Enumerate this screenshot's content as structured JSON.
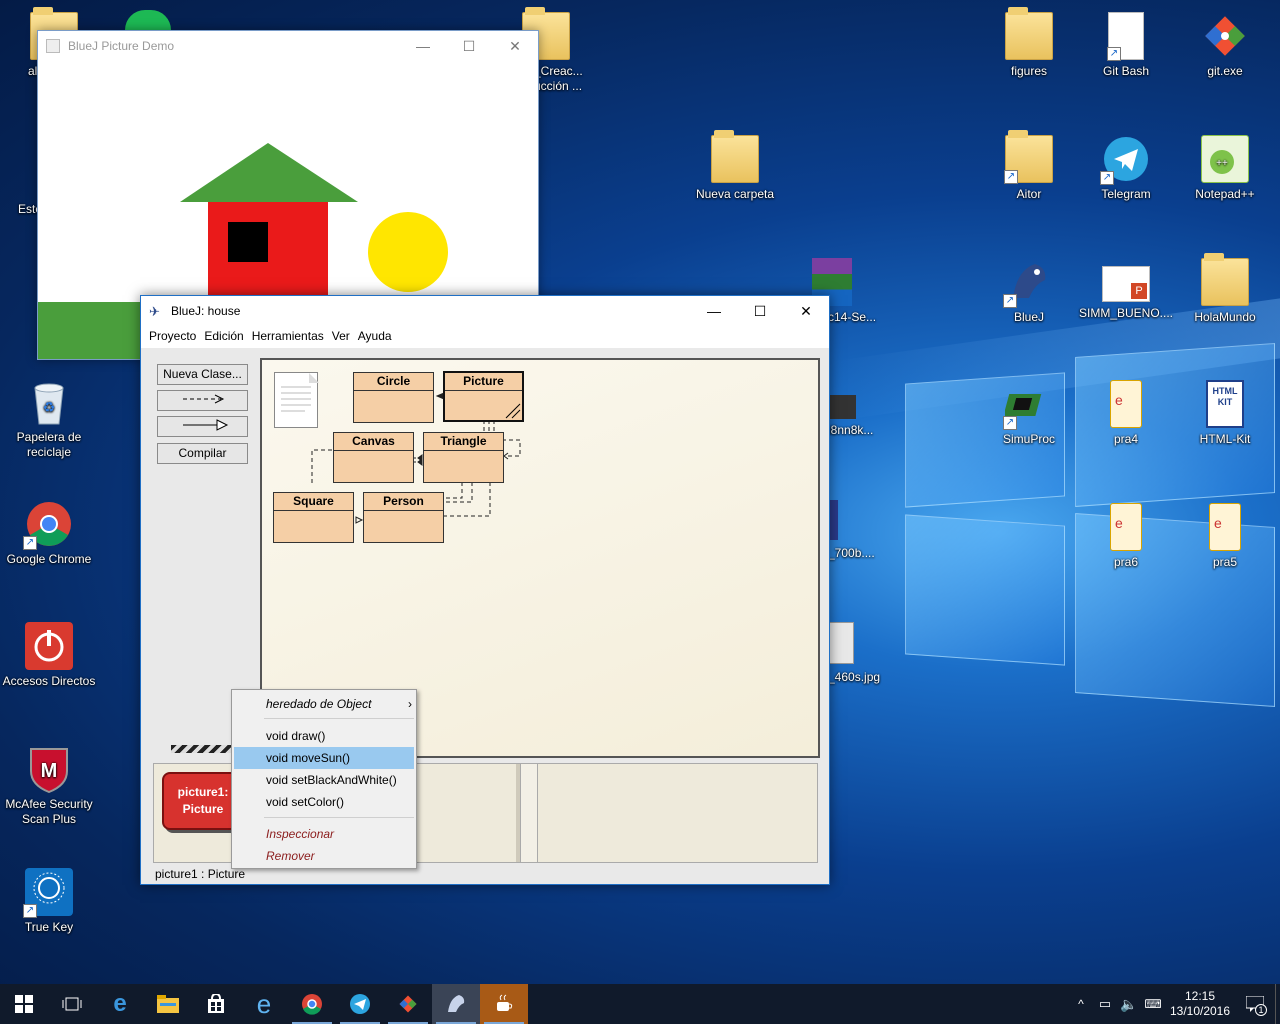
{
  "desktop": {
    "icons_left": [
      {
        "label": "al",
        "icon": "folder-icon"
      },
      {
        "label": "Este",
        "icon": "pc-icon"
      },
      {
        "label": "Papelera de reciclaje",
        "icon": "recycle-bin-icon"
      },
      {
        "label": "Google Chrome",
        "icon": "chrome-icon"
      },
      {
        "label": "Accesos Directos",
        "icon": "power-icon"
      },
      {
        "label": "McAfee Security Scan Plus",
        "icon": "mcafee-icon"
      },
      {
        "label": "True Key",
        "icon": "truekey-icon"
      }
    ],
    "icons_middle": [
      {
        "label": "_Creac... ucción ...",
        "icon": "folder-icon"
      },
      {
        "label": "Nueva carpeta",
        "icon": "folder-icon"
      },
      {
        "label": "c14-Se...",
        "icon": "winrar-icon"
      },
      {
        "label": "i8nn8k...",
        "icon": "image-icon"
      },
      {
        "label": "_700b....",
        "icon": "image-icon"
      },
      {
        "label": "_460s.jpg",
        "icon": "image-icon"
      }
    ],
    "icons_right": [
      {
        "label": "figures",
        "icon": "folder-icon"
      },
      {
        "label": "Git Bash",
        "icon": "gitbash-icon"
      },
      {
        "label": "git.exe",
        "icon": "git-icon"
      },
      {
        "label": "Aitor",
        "icon": "folder-icon"
      },
      {
        "label": "Telegram",
        "icon": "telegram-icon"
      },
      {
        "label": "Notepad++",
        "icon": "notepadpp-icon"
      },
      {
        "label": "BlueJ",
        "icon": "bluej-icon"
      },
      {
        "label": "SIMM_BUENO....",
        "icon": "powerpoint-icon"
      },
      {
        "label": "HolaMundo",
        "icon": "folder-icon"
      },
      {
        "label": "SimuProc",
        "icon": "chip-icon"
      },
      {
        "label": "pra4",
        "icon": "pdf-icon"
      },
      {
        "label": "HTML-Kit",
        "icon": "htmlkit-icon"
      },
      {
        "label": "pra6",
        "icon": "pdf-icon"
      },
      {
        "label": "pra5",
        "icon": "pdf-icon"
      }
    ]
  },
  "picture_window": {
    "title": "BlueJ Picture Demo",
    "colors": {
      "roof": "#4a9e3c",
      "wall": "#ea1a1a",
      "window": "#000000",
      "sun": "#ffe600",
      "grass": "#4a9e3c"
    }
  },
  "bluej": {
    "title": "BlueJ:  house",
    "menu": [
      "Proyecto",
      "Edición",
      "Herramientas",
      "Ver",
      "Ayuda"
    ],
    "buttons": {
      "new_class": "Nueva Clase...",
      "compile": "Compilar"
    },
    "classes": [
      "Circle",
      "Picture",
      "Canvas",
      "Triangle",
      "Square",
      "Person"
    ],
    "object": {
      "line1": "picture1:",
      "line2": "Picture"
    },
    "status": "picture1 : Picture"
  },
  "context_menu": {
    "inherited": "heredado de Object",
    "items": [
      "void draw()",
      "void moveSun()",
      "void setBlackAndWhite()",
      "void setColor()"
    ],
    "inspect": "Inspeccionar",
    "remove": "Remover",
    "selected": "void moveSun()"
  },
  "taskbar": {
    "time": "12:15",
    "date": "13/10/2016",
    "notification_count": "1"
  }
}
